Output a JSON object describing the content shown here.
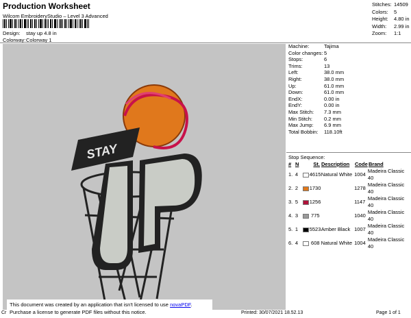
{
  "header": {
    "title": "Production Worksheet",
    "subtitle": "Wilcom EmbroideryStudio – Level 3 Advanced",
    "design_label": "Design:",
    "design_value": "stay up 4.8 in",
    "colorway_label": "Colorway:",
    "colorway_value": "Colorway 1"
  },
  "summary": [
    {
      "k": "Stitches:",
      "v": "14509"
    },
    {
      "k": "Colors:",
      "v": "5"
    },
    {
      "k": "Height:",
      "v": "4.80 in"
    },
    {
      "k": "Width:",
      "v": "2.99 in"
    },
    {
      "k": "Zoom:",
      "v": "1:1"
    }
  ],
  "machine_info": [
    {
      "k": "Machine:",
      "v": "Tajima"
    },
    {
      "k": "Color changes:",
      "v": "5"
    },
    {
      "k": "Stops:",
      "v": "6"
    },
    {
      "k": "Trims:",
      "v": "13"
    },
    {
      "k": "Left:",
      "v": "38.0 mm"
    },
    {
      "k": "Right:",
      "v": "38.0 mm"
    },
    {
      "k": "Up:",
      "v": "61.0 mm"
    },
    {
      "k": "Down:",
      "v": "61.0 mm"
    },
    {
      "k": "EndX:",
      "v": "0.00 in"
    },
    {
      "k": "EndY:",
      "v": "0.00 in"
    },
    {
      "k": "Max Stitch:",
      "v": "7.3 mm"
    },
    {
      "k": "Min Stitch:",
      "v": "0.2 mm"
    },
    {
      "k": "Max Jump:",
      "v": "6.9 mm"
    },
    {
      "k": "Total Bobbin:",
      "v": "118.10ft"
    }
  ],
  "stop_sequence": {
    "title": "Stop Sequence:",
    "headers": {
      "num": "#",
      "n": "N",
      "st": "St.",
      "desc": "Description",
      "code": "Code",
      "brand": "Brand"
    },
    "rows": [
      {
        "num": "1.",
        "n": "4",
        "color": "#ffffff",
        "st": "4615",
        "desc": "Natural White",
        "code": "1004",
        "brand": "Madeira Classic 40"
      },
      {
        "num": "2.",
        "n": "2",
        "color": "#e0781c",
        "st": "1730",
        "desc": "",
        "code": "1278",
        "brand": "Madeira Classic 40"
      },
      {
        "num": "3.",
        "n": "5",
        "color": "#b0123a",
        "st": "1256",
        "desc": "",
        "code": "1147",
        "brand": "Madeira Classic 40"
      },
      {
        "num": "4.",
        "n": "3",
        "color": "#9a9a9a",
        "st": "775",
        "desc": "",
        "code": "1040",
        "brand": "Madeira Classic 40"
      },
      {
        "num": "5.",
        "n": "1",
        "color": "#000000",
        "st": "5523",
        "desc": "Amber Black",
        "code": "1007",
        "brand": "Madeira Classic 40"
      },
      {
        "num": "6.",
        "n": "4",
        "color": "#ffffff",
        "st": "608",
        "desc": "Natural White",
        "code": "1004",
        "brand": "Madeira Classic 40"
      }
    ]
  },
  "design_text": {
    "stay": "STAY",
    "up": "UP"
  },
  "notice": {
    "line1": "This document was created by an application that isn't licensed to use ",
    "link": "novaPDF",
    "line1_end": ".",
    "line2": "Purchase a license to generate PDF files without this notice."
  },
  "footer": {
    "cr": "Cr",
    "printed": "Printed: 30/07/2021 18.52.13",
    "page": "Page 1 of 1"
  }
}
